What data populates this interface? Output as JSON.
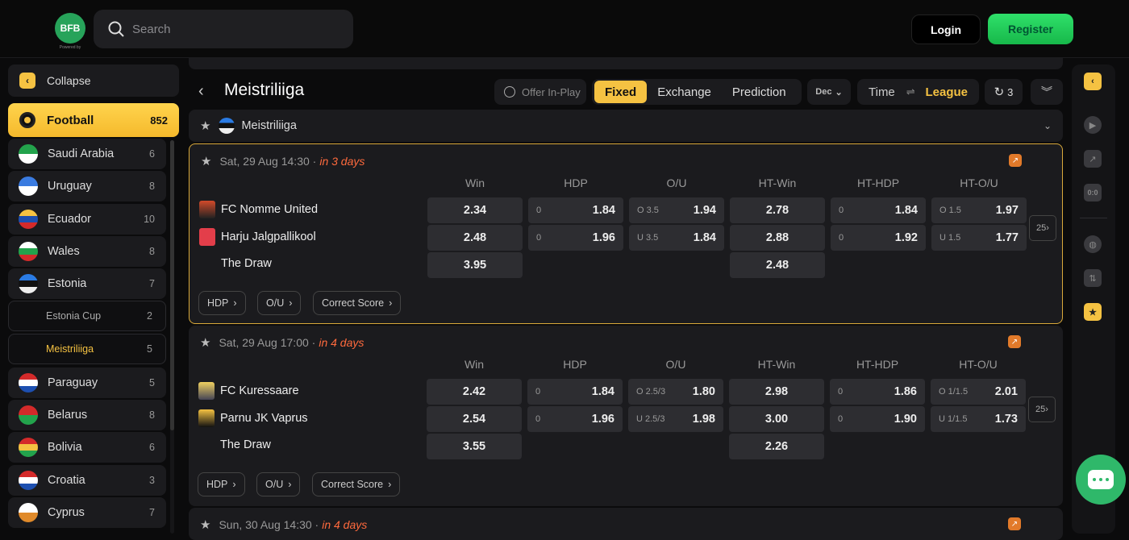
{
  "brand": {
    "logo_text": "BFB",
    "logo_sub": "Powered by"
  },
  "search": {
    "placeholder": "Search"
  },
  "auth": {
    "login": "Login",
    "register": "Register"
  },
  "sidebar": {
    "collapse": "Collapse",
    "sport": {
      "label": "Football",
      "count": "852"
    },
    "countries": [
      {
        "label": "Saudi Arabia",
        "count": "6",
        "colors": [
          "#23a34c",
          "#ffffff"
        ]
      },
      {
        "label": "Uruguay",
        "count": "8",
        "colors": [
          "#3a7be0",
          "#ffffff"
        ]
      },
      {
        "label": "Ecuador",
        "count": "10",
        "colors": [
          "#f5c242",
          "#1d4fb0",
          "#d42a2a"
        ]
      },
      {
        "label": "Wales",
        "count": "8",
        "colors": [
          "#ffffff",
          "#23a34c",
          "#d42a2a"
        ]
      },
      {
        "label": "Estonia",
        "count": "7",
        "colors": [
          "#2a7be4",
          "#111111",
          "#eeeeee"
        ]
      }
    ],
    "subs": [
      {
        "label": "Estonia Cup",
        "count": "2"
      },
      {
        "label": "Meistriliiga",
        "count": "5"
      }
    ],
    "countries2": [
      {
        "label": "Paraguay",
        "count": "5",
        "colors": [
          "#d42a2a",
          "#ffffff",
          "#1d4fb0"
        ]
      },
      {
        "label": "Belarus",
        "count": "8",
        "colors": [
          "#d42a2a",
          "#23a34c"
        ]
      },
      {
        "label": "Bolivia",
        "count": "6",
        "colors": [
          "#d42a2a",
          "#f5c242",
          "#23a34c"
        ]
      },
      {
        "label": "Croatia",
        "count": "3",
        "colors": [
          "#d42a2a",
          "#ffffff",
          "#1d4fb0"
        ]
      },
      {
        "label": "Cyprus",
        "count": "7",
        "colors": [
          "#ffffff",
          "#e08a2a"
        ]
      }
    ]
  },
  "header": {
    "title": "Meistriliiga",
    "offer": "Offer In-Play",
    "modes": [
      "Fixed",
      "Exchange",
      "Prediction"
    ],
    "odds_format": "Dec",
    "sort_time": "Time",
    "sort_league": "League",
    "refresh_count": "3"
  },
  "league_bar": "Meistriliiga",
  "columns": [
    "Win",
    "HDP",
    "O/U",
    "HT-Win",
    "HT-HDP",
    "HT-O/U"
  ],
  "markets": [
    "HDP",
    "O/U",
    "Correct Score"
  ],
  "matches": [
    {
      "date": "Sat, 29 Aug 14:30 · ",
      "when": "in 3 days",
      "home": "FC Nomme United",
      "away": "Harju Jalgpallikool",
      "draw": "The Draw",
      "win": [
        "2.34",
        "2.48",
        "3.95"
      ],
      "hdp": [
        [
          "0",
          "1.84"
        ],
        [
          "0",
          "1.96"
        ]
      ],
      "ou": [
        [
          "O 3.5",
          "1.94"
        ],
        [
          "U 3.5",
          "1.84"
        ]
      ],
      "htwin": [
        "2.78",
        "2.88",
        "2.48"
      ],
      "hthdp": [
        [
          "0",
          "1.84"
        ],
        [
          "0",
          "1.92"
        ]
      ],
      "htou": [
        [
          "O 1.5",
          "1.97"
        ],
        [
          "U 1.5",
          "1.77"
        ]
      ],
      "more": "25"
    },
    {
      "date": "Sat, 29 Aug 17:00 · ",
      "when": "in 4 days",
      "home": "FC Kuressaare",
      "away": "Parnu JK Vaprus",
      "draw": "The Draw",
      "win": [
        "2.42",
        "2.54",
        "3.55"
      ],
      "hdp": [
        [
          "0",
          "1.84"
        ],
        [
          "0",
          "1.96"
        ]
      ],
      "ou": [
        [
          "O 2.5/3",
          "1.80"
        ],
        [
          "U 2.5/3",
          "1.98"
        ]
      ],
      "htwin": [
        "2.98",
        "3.00",
        "2.26"
      ],
      "hthdp": [
        [
          "0",
          "1.86"
        ],
        [
          "0",
          "1.90"
        ]
      ],
      "htou": [
        [
          "O 1/1.5",
          "2.01"
        ],
        [
          "U 1/1.5",
          "1.73"
        ]
      ],
      "more": "25"
    },
    {
      "date": "Sun, 30 Aug 14:30 · ",
      "when": "in 4 days"
    }
  ],
  "colors": {
    "accent": "#f5c242",
    "register": "#22c95a",
    "time_hint": "#ff6a3d",
    "panel": "#1b1b1e",
    "cell": "#2d2d31"
  }
}
